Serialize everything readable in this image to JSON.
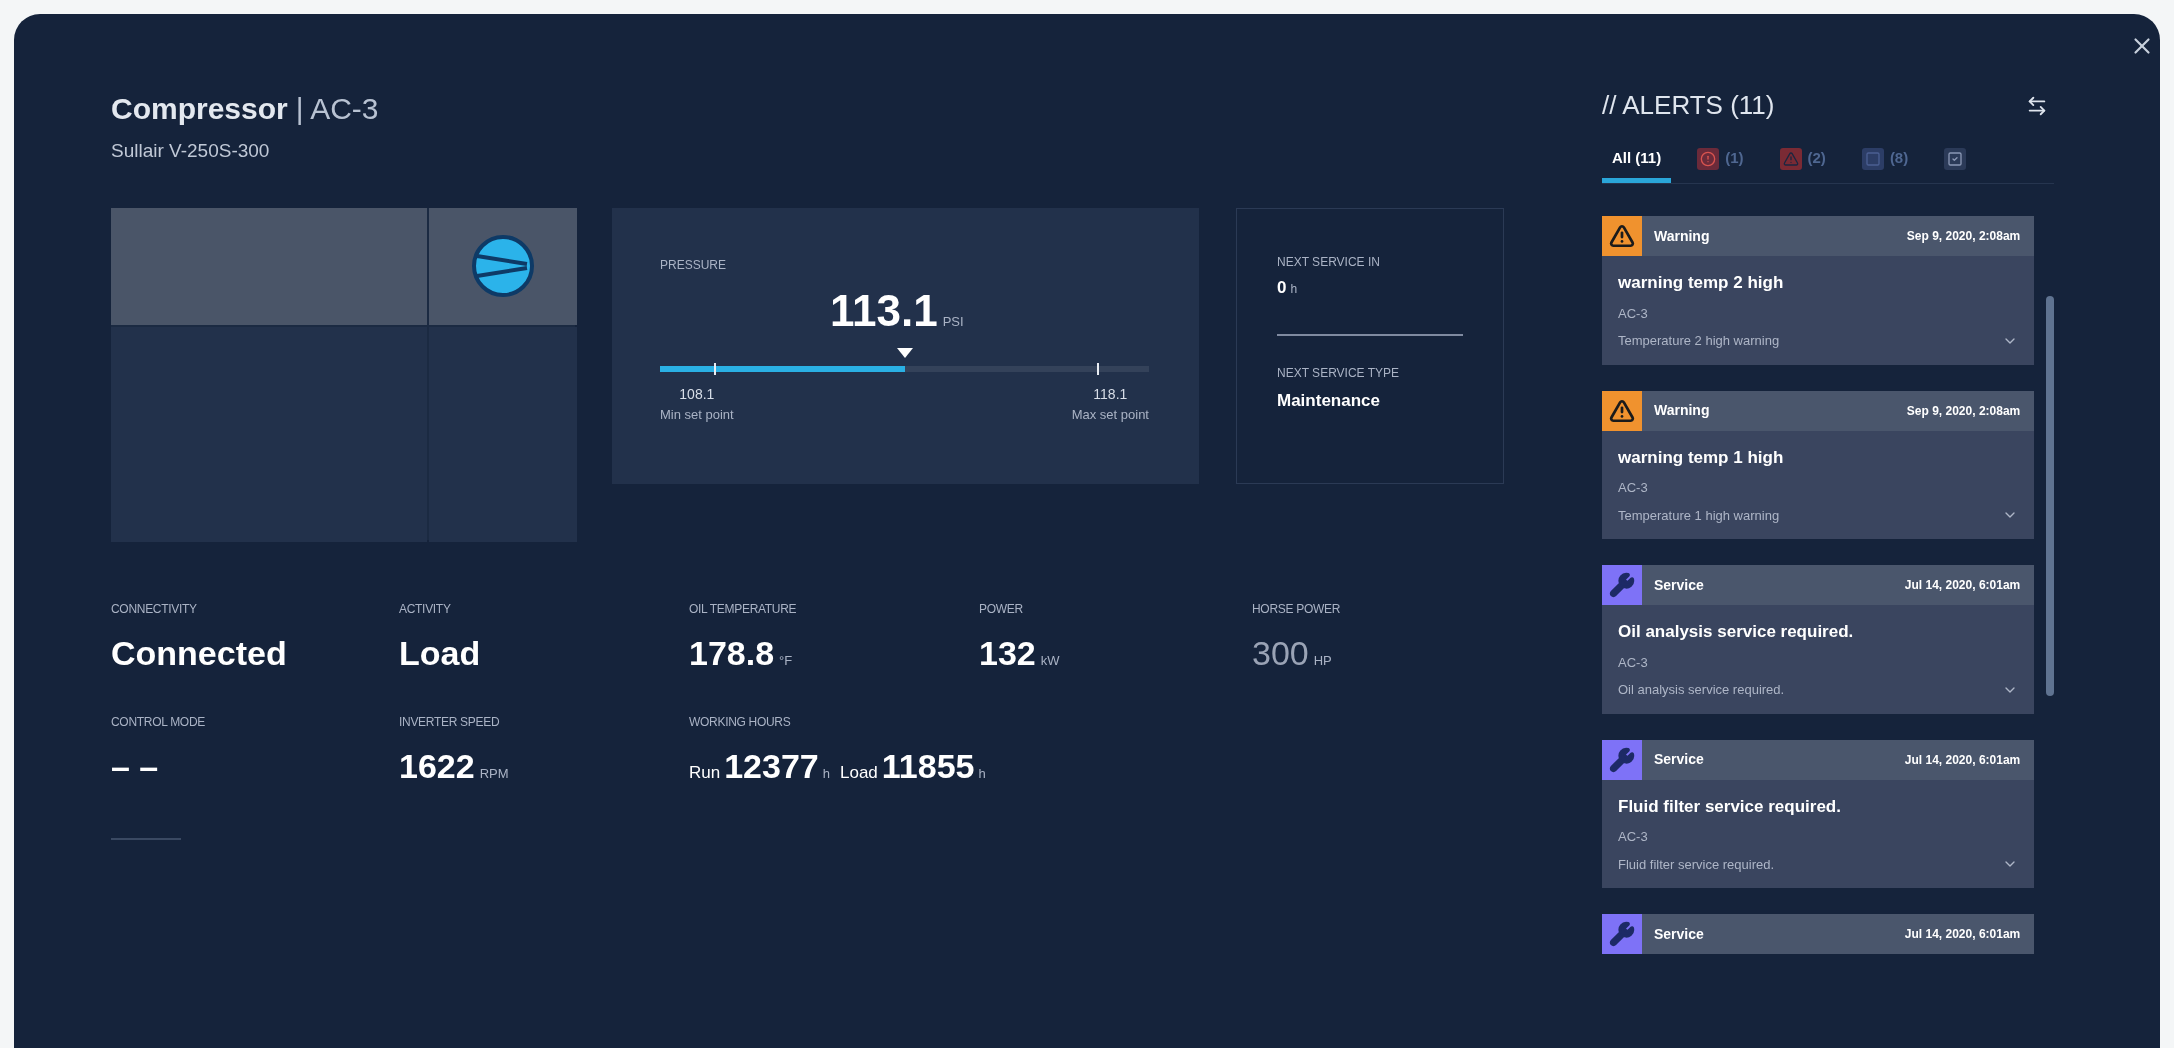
{
  "header": {
    "title": "Compressor",
    "tag": "| AC-3",
    "subtitle": "Sullair V-250S-300"
  },
  "pressure": {
    "label": "PRESSURE",
    "value": "113.1",
    "unit": "PSI",
    "level": 0.5,
    "min": {
      "value": "108.1",
      "label": "Min set point"
    },
    "max": {
      "value": "118.1",
      "label": "Max set point"
    }
  },
  "next_service": {
    "in_label": "NEXT SERVICE IN",
    "in_value": "0",
    "in_unit": "h",
    "type_label": "NEXT SERVICE TYPE",
    "type_value": "Maintenance"
  },
  "stats": [
    {
      "label": "CONNECTIVITY",
      "value": "Connected",
      "dimmed": false
    },
    {
      "label": "ACTIVITY",
      "value": "Load",
      "dimmed": false
    },
    {
      "label": "OIL TEMPERATURE",
      "value": "178.8",
      "unit": "°F",
      "dimmed": false
    },
    {
      "label": "POWER",
      "value": "132",
      "unit": "kW",
      "dimmed": false
    },
    {
      "label": "HORSE POWER",
      "value": "300",
      "unit": "HP",
      "dimmed": true
    },
    {
      "label": "CONTROL MODE",
      "value": "– –",
      "dimmed": false
    },
    {
      "label": "INVERTER SPEED",
      "value": "1622",
      "unit": "RPM",
      "dimmed": false
    },
    {
      "label": "WORKING HOURS",
      "parts": [
        {
          "prefix": "Run",
          "value": "12377",
          "unit": "h"
        },
        {
          "prefix": "Load",
          "value": "11855",
          "unit": "h"
        }
      ],
      "dimmed": false
    }
  ],
  "alerts": {
    "title": "// ALERTS (11)",
    "tabs": [
      {
        "kind": "text",
        "label": "All (11)",
        "selected": true
      },
      {
        "kind": "critical",
        "label": "(1)",
        "selected": false
      },
      {
        "kind": "alarm",
        "label": "(2)",
        "selected": false
      },
      {
        "kind": "service",
        "label": "(8)",
        "selected": false
      },
      {
        "kind": "resolved",
        "selected": false
      }
    ],
    "items": [
      {
        "kind": "warning",
        "type": "Warning",
        "date": "Sep 9, 2020, 2:08am",
        "title": "warning temp 2 high",
        "asset": "AC-3",
        "description": "Temperature 2 high warning"
      },
      {
        "kind": "warning",
        "type": "Warning",
        "date": "Sep 9, 2020, 2:08am",
        "title": "warning temp 1 high",
        "asset": "AC-3",
        "description": "Temperature 1 high warning"
      },
      {
        "kind": "service",
        "type": "Service",
        "date": "Jul 14, 2020, 6:01am",
        "title": "Oil analysis service required.",
        "asset": "AC-3",
        "description": "Oil analysis service required."
      },
      {
        "kind": "service",
        "type": "Service",
        "date": "Jul 14, 2020, 6:01am",
        "title": "Fluid filter service required.",
        "asset": "AC-3",
        "description": "Fluid filter service required."
      },
      {
        "kind": "service",
        "type": "Service",
        "date": "Jul 14, 2020, 6:01am"
      }
    ]
  }
}
